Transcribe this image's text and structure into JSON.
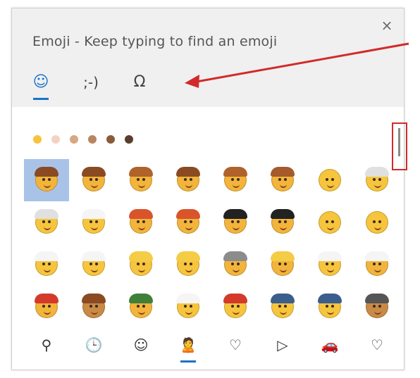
{
  "header": {
    "title": "Emoji - Keep typing to find an emoji",
    "close_label": "×"
  },
  "tabs": [
    {
      "label": "☺",
      "name": "tab-emoji",
      "active": true
    },
    {
      "label": ";-)",
      "name": "tab-kaomoji",
      "active": false
    },
    {
      "label": "Ω",
      "name": "tab-symbols",
      "active": false
    }
  ],
  "skin_tones": [
    "#f7c33c",
    "#f4d2c2",
    "#d5a883",
    "#b98561",
    "#8a5b39",
    "#5a3d2b"
  ],
  "emoji_rows": [
    [
      {
        "face": "#f2b43b",
        "hair": "#8a4a22"
      },
      {
        "face": "#f2b43b",
        "hair": "#8a4a22"
      },
      {
        "face": "#f2b43b",
        "hair": "#b0622b"
      },
      {
        "face": "#f2b43b",
        "hair": "#8a4a22"
      },
      {
        "face": "#f2b43b",
        "hair": "#b0622b"
      },
      {
        "face": "#f2b43b",
        "hair": "#a45a2a"
      },
      {
        "face": "#f6c53d",
        "hair": ""
      },
      {
        "face": "#f6c53d",
        "hair": "#e0e0e0"
      }
    ],
    [
      {
        "face": "#f6c53d",
        "hair": "#e0e0e0"
      },
      {
        "face": "#f6c53d",
        "hair": "#f5f5f5"
      },
      {
        "face": "#f2b43b",
        "hair": "#d9542b"
      },
      {
        "face": "#f2b43b",
        "hair": "#d9542b"
      },
      {
        "face": "#f2b43b",
        "hair": "#222222"
      },
      {
        "face": "#f2b43b",
        "hair": "#222222"
      },
      {
        "face": "#f6c53d",
        "hair": ""
      },
      {
        "face": "#f6c53d",
        "hair": ""
      }
    ],
    [
      {
        "face": "#f6c53d",
        "hair": "#f5f5f5"
      },
      {
        "face": "#f6c53d",
        "hair": "#f5f5f5"
      },
      {
        "face": "#f6c53d",
        "hair": "#f4cc45"
      },
      {
        "face": "#f6c53d",
        "hair": "#f4cc45"
      },
      {
        "face": "#f2b43b",
        "hair": "#8c8c8c"
      },
      {
        "face": "#f2b43b",
        "hair": "#f4cc45"
      },
      {
        "face": "#f6c53d",
        "hair": "#f5f5f5"
      },
      {
        "face": "#f2b43b",
        "hair": "#f5f5f5"
      }
    ],
    [
      {
        "face": "#f2b43b",
        "hair": "#d33a2a"
      },
      {
        "face": "#c98a45",
        "hair": "#8a4a22"
      },
      {
        "face": "#f2b43b",
        "hair": "#3f7f3a"
      },
      {
        "face": "#f6c53d",
        "hair": "#f5f5f5"
      },
      {
        "face": "#f6c53d",
        "hair": "#d33a2a"
      },
      {
        "face": "#f6c53d",
        "hair": "#3b5e8c"
      },
      {
        "face": "#f6c53d",
        "hair": "#3b5e8c"
      },
      {
        "face": "#c98a45",
        "hair": "#555555"
      }
    ]
  ],
  "bottom_categories": [
    {
      "label": "⚲",
      "name": "category-search-icon"
    },
    {
      "label": "🕒",
      "name": "category-recent-icon"
    },
    {
      "label": "☺",
      "name": "category-smileys-icon"
    },
    {
      "label": "🙎",
      "name": "category-people-icon",
      "active": true
    },
    {
      "label": "♡",
      "name": "category-celebrations-icon"
    },
    {
      "label": "▷",
      "name": "category-food-icon"
    },
    {
      "label": "🚗",
      "name": "category-travel-icon"
    },
    {
      "label": "♡",
      "name": "category-symbols-icon"
    }
  ],
  "colors": {
    "accent": "#1a73c7",
    "selection": "#a9c3e8",
    "annotation_red": "#d22a2a"
  }
}
